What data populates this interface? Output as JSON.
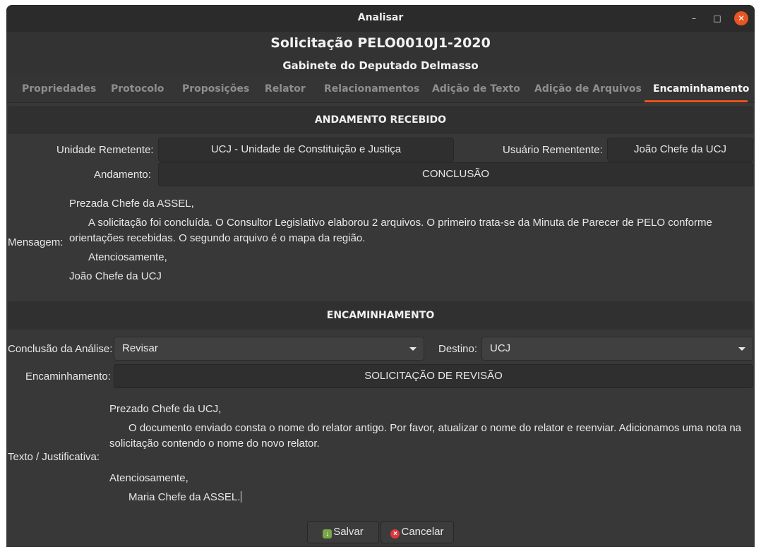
{
  "window": {
    "title": "Analisar",
    "controls": {
      "minimize": "–",
      "maximize": "□",
      "close": "✕"
    }
  },
  "header": {
    "title": "Solicitação PELO0010J1-2020",
    "subtitle": "Gabinete do Deputado Delmasso"
  },
  "tabs": [
    {
      "label": "Propriedades",
      "active": false
    },
    {
      "label": "Protocolo",
      "active": false
    },
    {
      "label": "Proposições",
      "active": false
    },
    {
      "label": "Relator",
      "active": false
    },
    {
      "label": "Relacionamentos",
      "active": false
    },
    {
      "label": "Adição de Texto",
      "active": false
    },
    {
      "label": "Adição de Arquivos",
      "active": false
    },
    {
      "label": "Encaminhamento",
      "active": true
    }
  ],
  "received": {
    "heading": "ANDAMENTO RECEBIDO",
    "sender_unit_label": "Unidade Remetente:",
    "sender_unit_value": "UCJ - Unidade de Constituição e Justiça",
    "sender_user_label": "Usuário Rementente:",
    "sender_user_value": "João Chefe da UCJ",
    "status_label": "Andamento:",
    "status_value": "CONCLUSÃO",
    "message_label": "Mensagem:",
    "message_lines": {
      "greeting": "Prezada Chefe da ASSEL,",
      "body1": "A solicitação foi concluída. O Consultor Legislativo elaborou 2 arquivos. O primeiro trata-se da Minuta de Parecer de PELO conforme",
      "body2": "orientações recebidas. O segundo arquivo é o mapa da região.",
      "closing": "Atenciosamente,",
      "signature": "João Chefe da UCJ"
    }
  },
  "forward": {
    "heading": "ENCAMINHAMENTO",
    "conclusion_label": "Conclusão da Análise:",
    "conclusion_value": "Revisar",
    "destination_label": "Destino:",
    "destination_value": "UCJ",
    "forwarding_label": "Encaminhamento:",
    "forwarding_value": "SOLICITAÇÃO DE REVISÃO",
    "justification_label": "Texto / Justificativa:",
    "justification_lines": {
      "greeting": "Prezado Chefe da UCJ,",
      "body1": "O documento enviado consta o nome do relator antigo. Por favor, atualizar o nome do relator e reenviar. Adicionamos uma nota na",
      "body2": "solicitação contendo o nome do novo relator.",
      "closing": "Atenciosamente,",
      "signature": "Maria Chefe da ASSEL."
    }
  },
  "buttons": {
    "save_label": "Salvar",
    "cancel_label": "Cancelar"
  },
  "colors": {
    "accent": "#e95420",
    "window_bg": "#383838",
    "field_bg": "#2f2f2f"
  }
}
